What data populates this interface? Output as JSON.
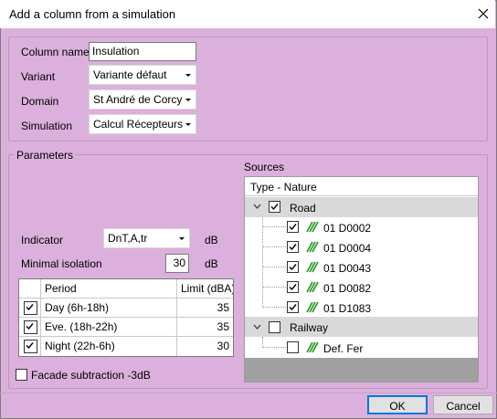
{
  "window": {
    "title": "Add a column from a simulation"
  },
  "form": {
    "column_name_label": "Column name",
    "column_name_value": "Insulation",
    "variant_label": "Variant",
    "variant_value": "Variante défaut",
    "domain_label": "Domain",
    "domain_value": "St André de Corcy",
    "simulation_label": "Simulation",
    "simulation_value": "Calcul Récepteurs"
  },
  "parameters": {
    "group_label": "Parameters",
    "indicator_label": "Indicator",
    "indicator_value": "DnT,A,tr",
    "indicator_unit": "dB",
    "min_isolation_label": "Minimal isolation",
    "min_isolation_value": "30",
    "min_isolation_unit": "dB",
    "table": {
      "col_period": "Period",
      "col_limit": "Limit (dBA)",
      "rows": [
        {
          "checked": true,
          "period": "Day (6h-18h)",
          "limit": "35"
        },
        {
          "checked": true,
          "period": "Eve. (18h-22h)",
          "limit": "35"
        },
        {
          "checked": true,
          "period": "Night (22h-6h)",
          "limit": "30"
        }
      ]
    },
    "facade_label": "Facade subtraction -3dB",
    "facade_checked": false
  },
  "sources": {
    "label": "Sources",
    "header": "Type - Nature",
    "road_label": "Road",
    "road_items": [
      "01 D0002",
      "01 D0004",
      "01 D0043",
      "01 D0082",
      "01 D1083"
    ],
    "railway_label": "Railway",
    "railway_items": [
      "Def. Fer"
    ]
  },
  "buttons": {
    "ok": "OK",
    "cancel": "Cancel"
  },
  "colors": {
    "background": "#dcb0dc",
    "accent": "#0078d7",
    "road_icon": "#2e9e2e"
  }
}
